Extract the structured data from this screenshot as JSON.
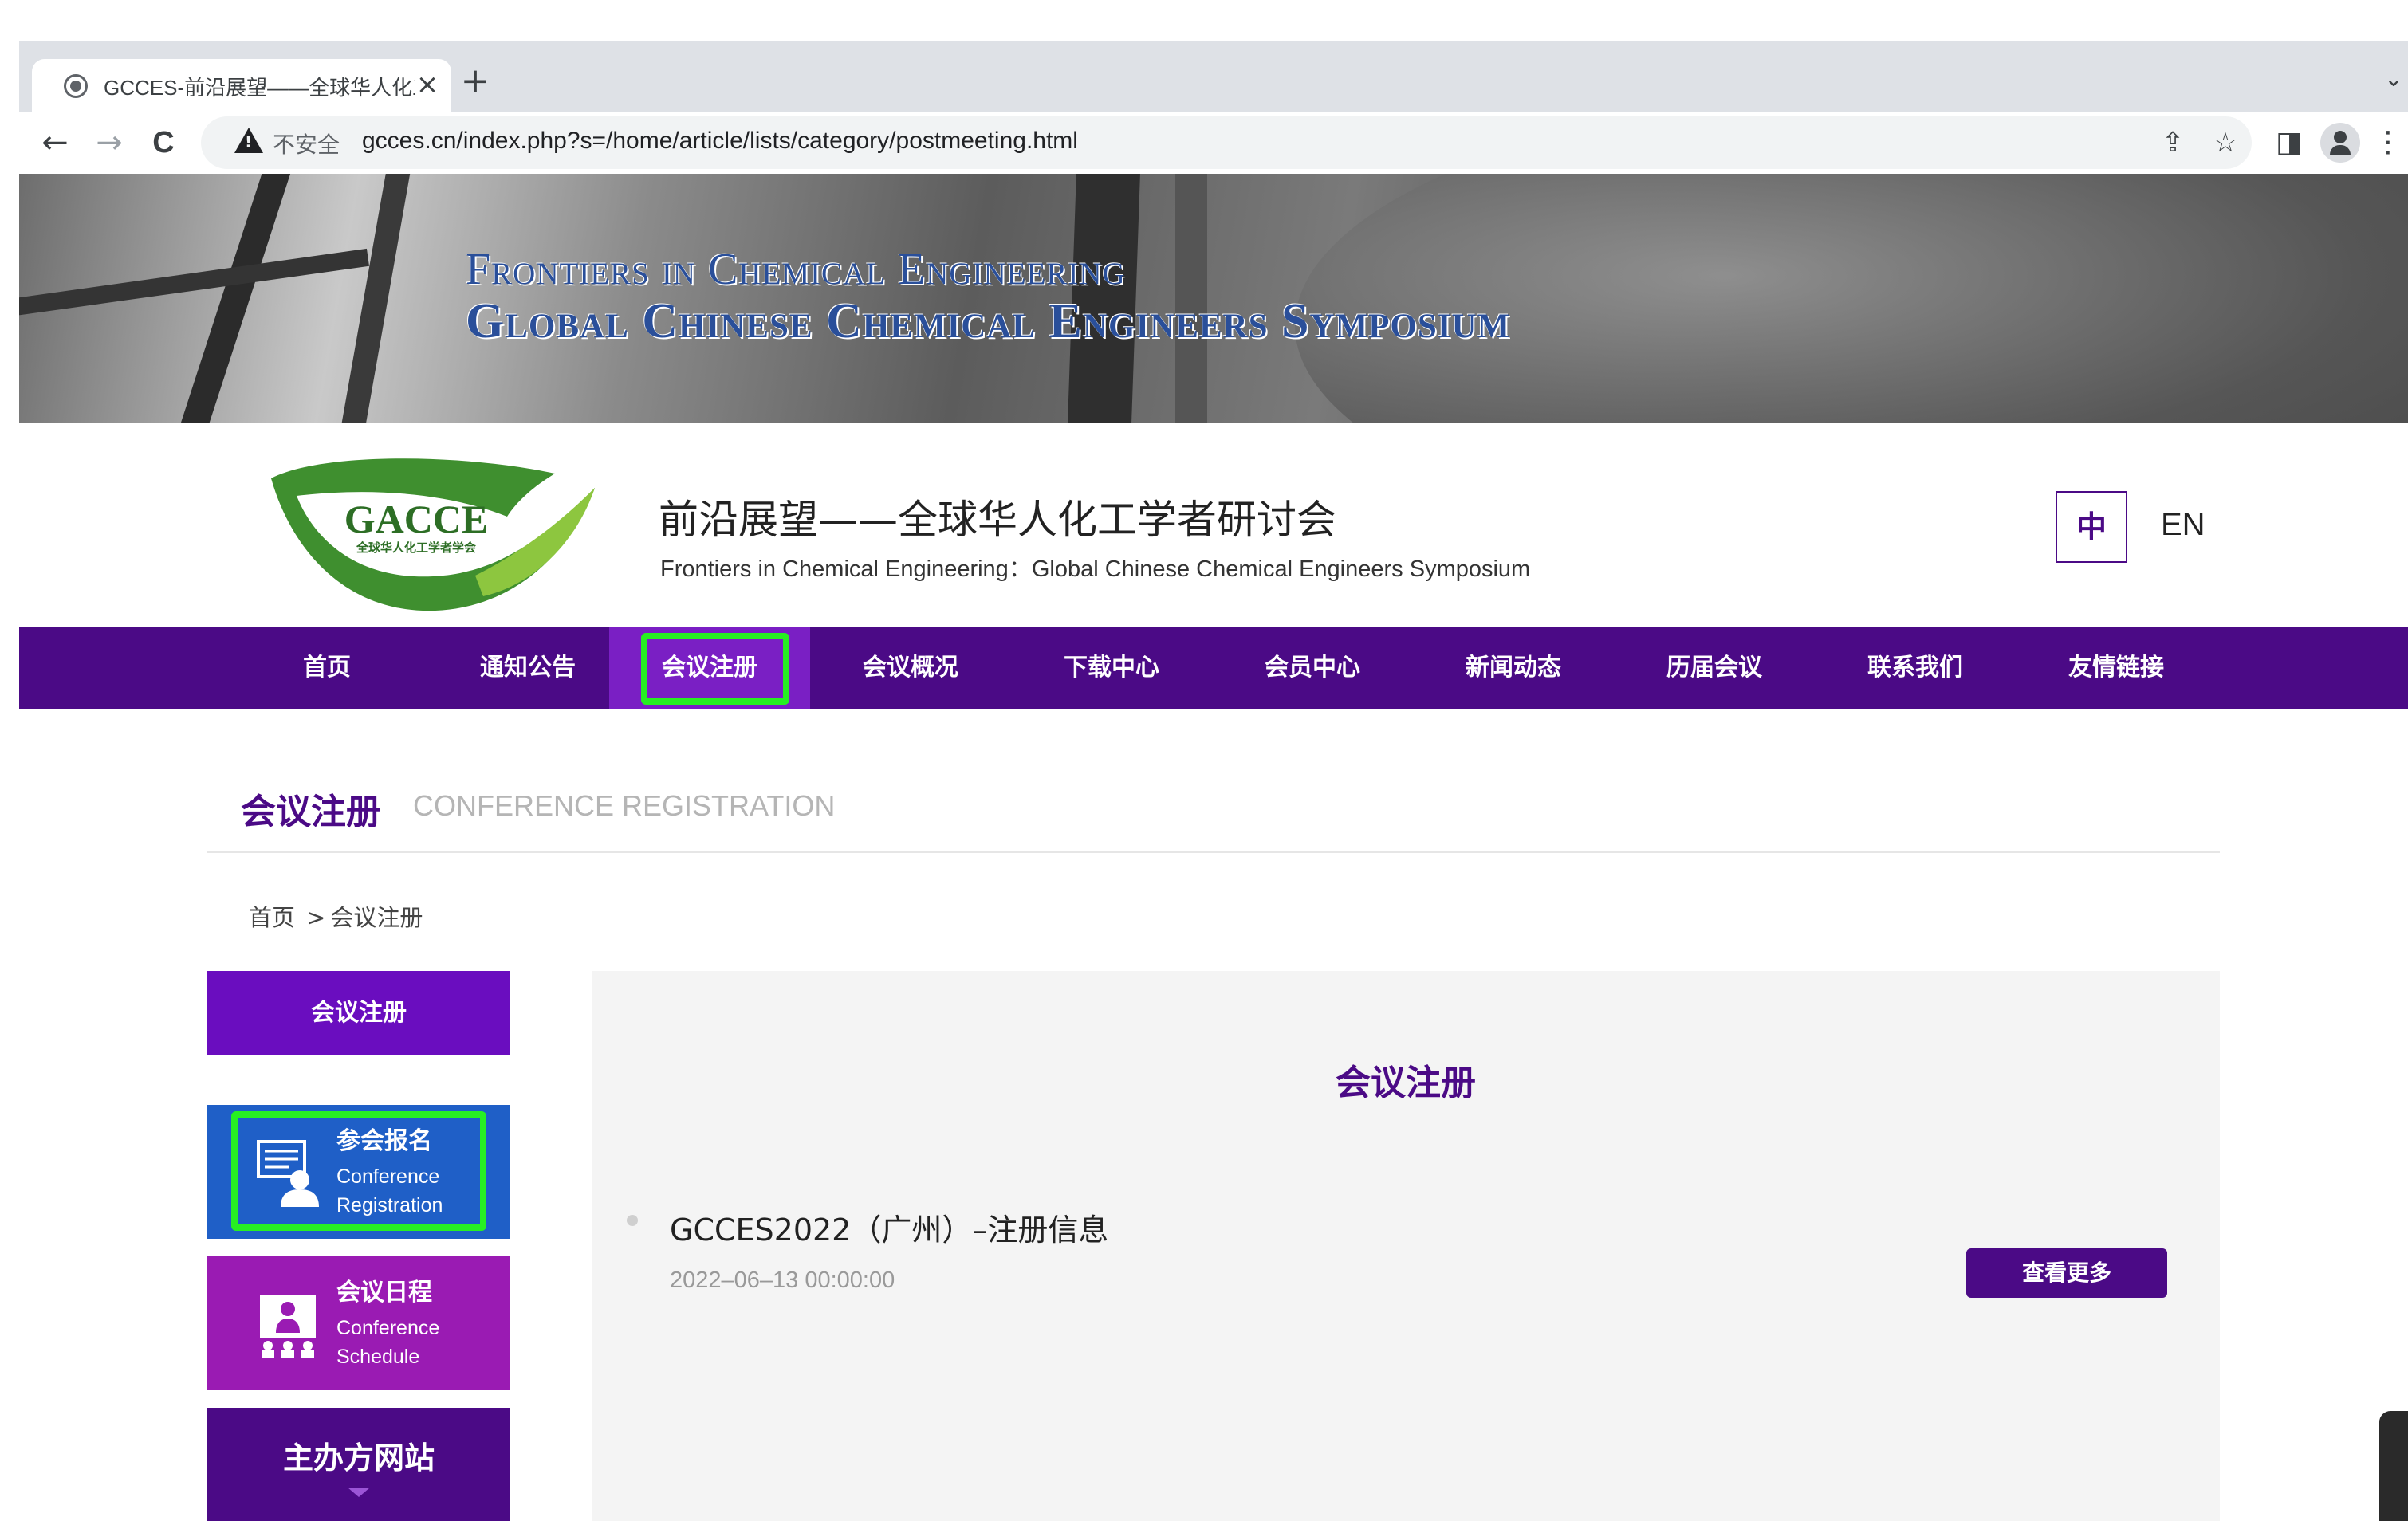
{
  "browser": {
    "tab_title": "GCCES-前沿展望——全球华人化工学者研讨会",
    "tab_close": "×",
    "new_tab": "+",
    "tab_list": "⌄",
    "back": "←",
    "forward": "→",
    "reload": "C",
    "security_label": "不安全",
    "url": "gcces.cn/index.php?s=/home/article/lists/category/postmeeting.html",
    "share": "⇪",
    "bookmark": "☆",
    "side_panel": "◨",
    "menu": "⋮"
  },
  "banner": {
    "line1": "Frontiers in Chemical Engineering",
    "line2": "Global Chinese Chemical Engineers Symposium"
  },
  "header": {
    "logo_text": "GACCE",
    "logo_subtext": "全球华人化工学者学会",
    "title_cn": "前沿展望——全球华人化工学者研讨会",
    "title_en": "Frontiers in Chemical Engineering：Global Chinese Chemical Engineers Symposium",
    "lang_cn": "中",
    "lang_en": "EN"
  },
  "nav": {
    "items": [
      {
        "label": "首页"
      },
      {
        "label": "通知公告"
      },
      {
        "label": "会议注册"
      },
      {
        "label": "会议概况"
      },
      {
        "label": "下载中心"
      },
      {
        "label": "会员中心"
      },
      {
        "label": "新闻动态"
      },
      {
        "label": "历届会议"
      },
      {
        "label": "联系我们"
      },
      {
        "label": "友情链接"
      }
    ],
    "active_index": 2
  },
  "section": {
    "title": "会议注册",
    "subtitle": "CONFERENCE REGISTRATION"
  },
  "breadcrumb": {
    "home": "首页",
    "separator": ">",
    "current": "会议注册"
  },
  "sidebar": {
    "header": "会议注册",
    "cards": [
      {
        "title_cn": "参会报名",
        "title_en_1": "Conference",
        "title_en_2": "Registration",
        "color": "#1f5fc7"
      },
      {
        "title_cn": "会议日程",
        "title_en_1": "Conference",
        "title_en_2": "Schedule",
        "color": "#9a1bb3"
      }
    ],
    "footer": "主办方网站"
  },
  "content": {
    "title": "会议注册",
    "items": [
      {
        "title": "GCCES2022（广州）–注册信息",
        "date": "2022–06–13 00:00:00",
        "button": "查看更多"
      }
    ]
  },
  "colors": {
    "brand_purple": "#4b0a86",
    "active_nav": "#7a1fc4",
    "highlight_green": "#27ef22"
  }
}
